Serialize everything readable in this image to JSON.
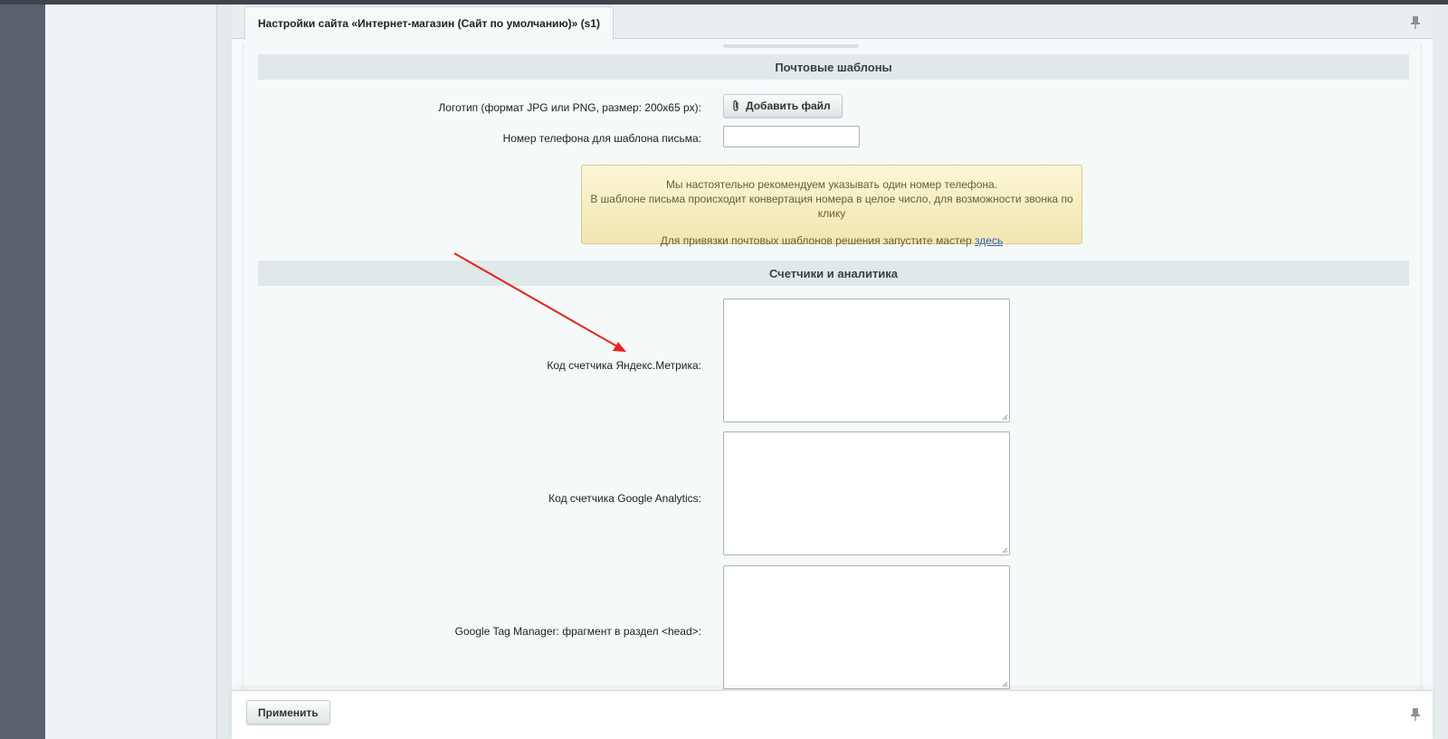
{
  "tab": {
    "title": "Настройки сайта «Интернет-магазин (Сайт по умолчанию)» (s1)"
  },
  "sections": {
    "mail": {
      "title": "Почтовые шаблоны"
    },
    "counters": {
      "title": "Счетчики и аналитика"
    }
  },
  "fields": {
    "logo_label": "Логотип (формат JPG или PNG, размер: 200x65 px):",
    "add_file_label": "Добавить файл",
    "phone_label": "Номер телефона для шаблона письма:",
    "phone_value": "",
    "yandex_label": "Код счетчика Яндекс.Метрика:",
    "google_label": "Код счетчика Google Analytics:",
    "gtm_label": "Google Tag Manager: фрагмент в раздел <head>:"
  },
  "notice": {
    "line1": "Мы настоятельно рекомендуем указывать один номер телефона.",
    "line2": "В шаблоне письма происходит конвертация номера в целое число, для возможности звонка по клику",
    "line3_prefix": "Для привязки почтовых шаблонов решения запустите мастер ",
    "link": "здесь"
  },
  "footer": {
    "apply_label": "Применить"
  },
  "icons": {
    "pin": "pin-icon",
    "paperclip": "paperclip-icon",
    "resize": "resize-grip-icon"
  },
  "colors": {
    "arrow": "#e8231c",
    "notice_bg": "#f6efc6",
    "section_bg": "#e0e8ea"
  }
}
